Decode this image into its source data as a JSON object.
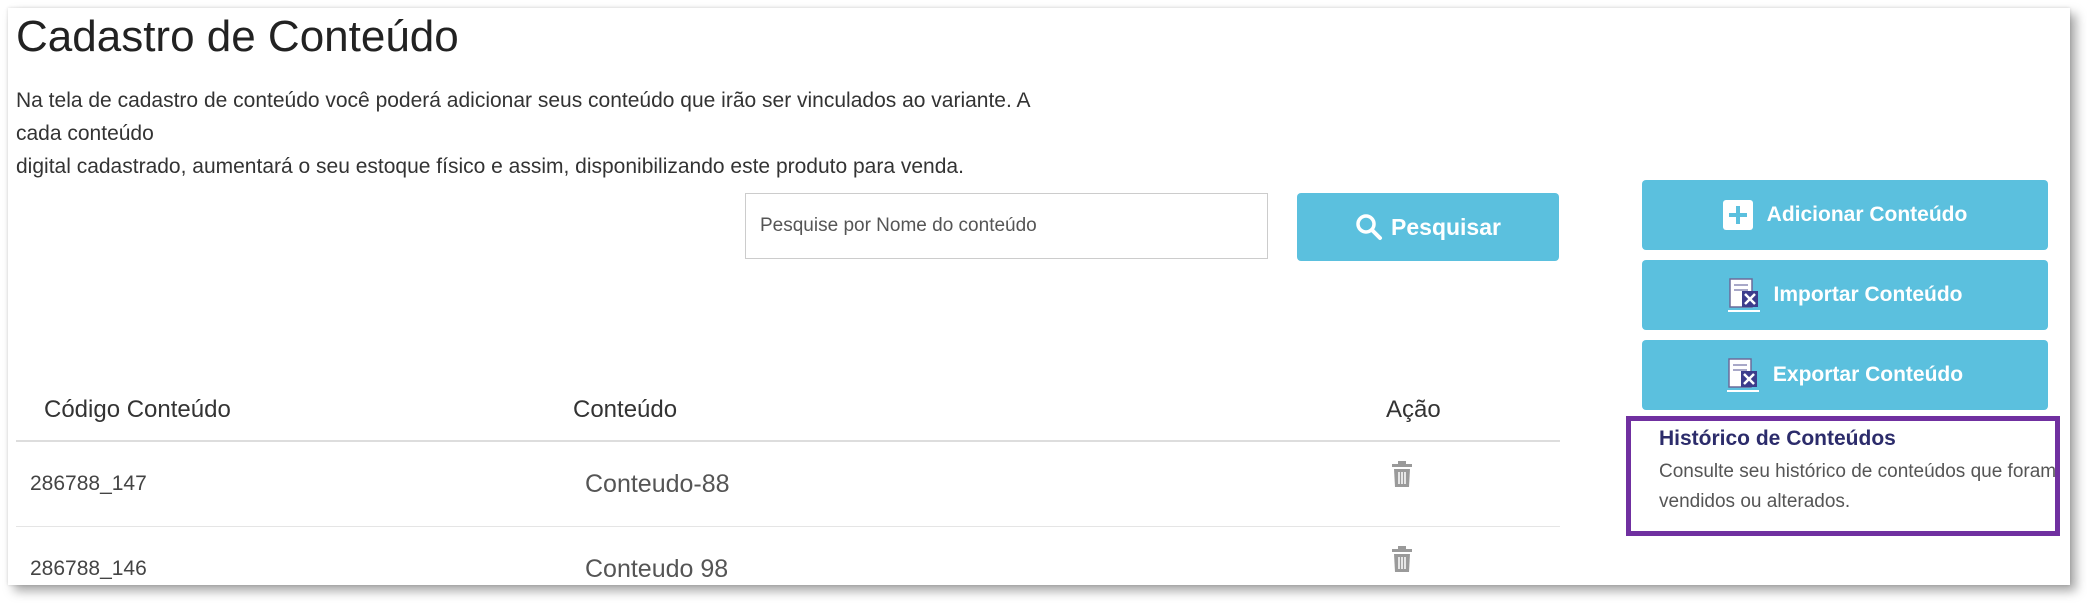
{
  "page": {
    "title": "Cadastro de Conteúdo",
    "description_lines": [
      "Na tela de cadastro de conteúdo você poderá adicionar seus conteúdo que irão ser vinculados ao variante. A",
      "cada conteúdo",
      "digital cadastrado, aumentará o seu estoque físico e assim, disponibilizando este produto para venda."
    ]
  },
  "search": {
    "placeholder": "Pesquise por Nome do conteúdo",
    "value": "",
    "button_label": "Pesquisar",
    "button_icon": "search-icon"
  },
  "actions": {
    "add_label": "Adicionar Conteúdo",
    "add_icon": "plus-square-icon",
    "import_label": "Importar Conteúdo",
    "import_icon": "excel-file-icon",
    "export_label": "Exportar Conteúdo",
    "export_icon": "excel-file-icon"
  },
  "history": {
    "title": "Histórico de Conteúdos",
    "text": "Consulte seu histórico de conteúdos que foram vendidos ou alterados."
  },
  "table": {
    "headers": [
      "Código Conteúdo",
      "Conteúdo",
      "Ação"
    ],
    "rows": [
      {
        "code": "286788_147",
        "content": "Conteudo-88",
        "action_icon": "trash-icon"
      },
      {
        "code": "286788_146",
        "content": "Conteudo 98",
        "action_icon": "trash-icon"
      }
    ]
  },
  "colors": {
    "button_bg": "#5bc0de",
    "button_text": "#ffffff",
    "highlight_border": "#7030a0",
    "history_title": "#2c2c6b"
  }
}
